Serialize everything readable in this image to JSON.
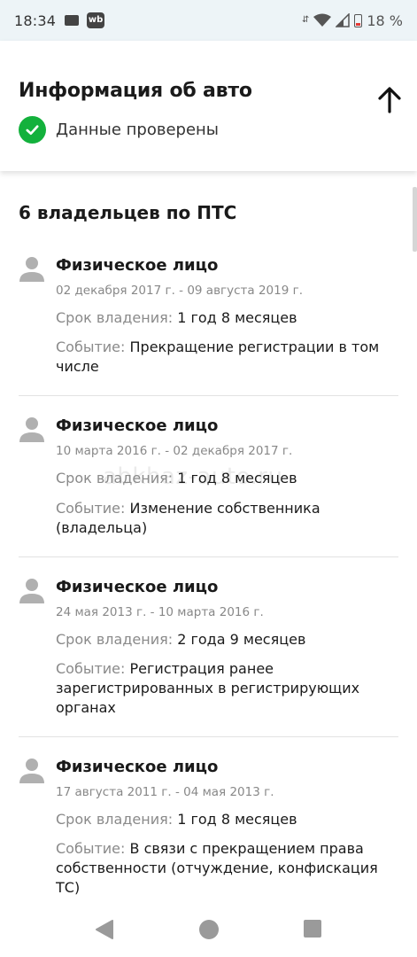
{
  "status_bar": {
    "time": "18:34",
    "wb_label": "wb",
    "battery": "18 %",
    "data_arrows": "⇵",
    "icons": [
      "message-icon",
      "wildberries-icon",
      "data-icon",
      "wifi-icon",
      "signal-icon",
      "battery-icon"
    ]
  },
  "header": {
    "title": "Информация об авто",
    "verified_text": "Данные проверены",
    "accent_color": "#13b13c"
  },
  "owners_title": "6 владельцев по ПТС",
  "watermark": "abkhaz-auto.ru",
  "owners": [
    {
      "type": "Физическое лицо",
      "dates": "02 декабря 2017 г. - 09 августа 2019 г.",
      "duration_label": "Срок владения:",
      "duration": "1 год 8 месяцев",
      "event_label": "Событие:",
      "event": "Прекращение регистрации в том числе"
    },
    {
      "type": "Физическое лицо",
      "dates": "10 марта 2016 г. - 02 декабря 2017 г.",
      "duration_label": "Срок владения:",
      "duration": "1 год 8 месяцев",
      "event_label": "Событие:",
      "event": "Изменение собственника (владельца)"
    },
    {
      "type": "Физическое лицо",
      "dates": "24 мая 2013 г. - 10 марта 2016 г.",
      "duration_label": "Срок владения:",
      "duration": "2 года 9 месяцев",
      "event_label": "Событие:",
      "event": "Регистрация ранее зарегистрированных в регистрирующих органах"
    },
    {
      "type": "Физическое лицо",
      "dates": "17 августа 2011 г. - 04 мая 2013 г.",
      "duration_label": "Срок владения:",
      "duration": "1 год 8 месяцев",
      "event_label": "Событие:",
      "event": "В связи с прекращением права собственности (отчуждение, конфискация ТС)"
    }
  ]
}
